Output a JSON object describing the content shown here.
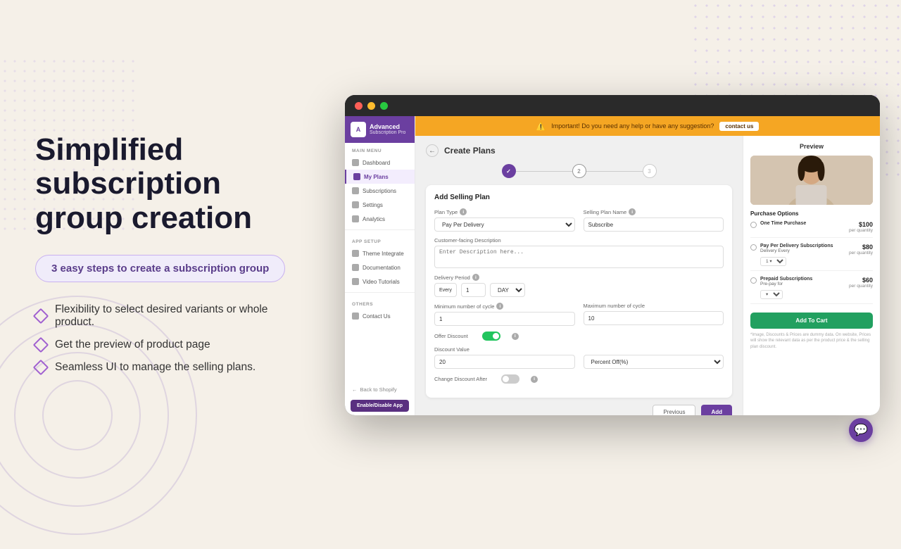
{
  "page": {
    "background": "#f5f0e8"
  },
  "left": {
    "title_line1": "Simplified subscription",
    "title_line2": "group creation",
    "badge": "3 easy steps to create a subscription group",
    "features": [
      "Flexibility to select desired variants or whole product.",
      "Get the preview of product page",
      "Seamless UI to manage the selling plans."
    ]
  },
  "app": {
    "title_bar": {
      "dot_red": "red",
      "dot_yellow": "yellow",
      "dot_green": "green"
    },
    "sidebar": {
      "logo_text": "Advanced",
      "logo_sub": "Subscription Pro",
      "main_menu_label": "MAIN MENU",
      "items": [
        {
          "label": "Dashboard",
          "active": false
        },
        {
          "label": "My Plans",
          "active": true
        },
        {
          "label": "Subscriptions",
          "active": false
        },
        {
          "label": "Settings",
          "active": false
        },
        {
          "label": "Analytics",
          "active": false
        }
      ],
      "app_setup_label": "APP SETUP",
      "setup_items": [
        {
          "label": "Theme Integrate"
        },
        {
          "label": "Documentation"
        },
        {
          "label": "Video Tutorials"
        }
      ],
      "others_label": "OTHERS",
      "other_items": [
        {
          "label": "Contact Us"
        }
      ],
      "back_to_shopify": "Back to Shopify",
      "enable_btn": "Enable/Disable App"
    },
    "warning_bar": {
      "text": "Important! Do you need any help or have any suggestion?",
      "contact_btn": "contact us"
    },
    "form": {
      "title": "Create Plans",
      "steps": [
        {
          "label": "✓",
          "state": "done"
        },
        {
          "label": "2",
          "state": "current"
        },
        {
          "label": "3",
          "state": "future"
        }
      ],
      "card_title": "Add Selling Plan",
      "plan_type_label": "Plan Type",
      "plan_type_value": "Pay Per Delivery",
      "selling_plan_name_label": "Selling Plan Name",
      "selling_plan_name_value": "Subscribe",
      "description_label": "Customer-facing Description",
      "description_placeholder": "Enter Description here...",
      "delivery_period_label": "Delivery Period",
      "delivery_every_label": "Every",
      "delivery_value": "1",
      "delivery_day": "DAY",
      "min_cycle_label": "Minimum number of cycle",
      "min_cycle_value": "1",
      "max_cycle_label": "Maximum number of cycle",
      "max_cycle_value": "10",
      "offer_discount_label": "Offer Discount",
      "toggle_state": "on",
      "discount_value_label": "Discount Value",
      "discount_value": "20",
      "percent_label": "Percent Off(%)",
      "change_discount_label": "Change Discount After",
      "change_discount_toggle": "off",
      "btn_previous": "Previous",
      "btn_add": "Add"
    },
    "preview": {
      "title": "Preview",
      "purchase_options_label": "Purchase Options",
      "options": [
        {
          "name": "One Time Purchase",
          "price": "$100",
          "price_sub": "per quantity"
        },
        {
          "name": "Pay Per Delivery Subscriptions",
          "price": "$80",
          "price_sub": "per quantity",
          "sub_label": "Delivery Every",
          "sub_select": "1 ▼"
        },
        {
          "name": "Prepaid Subscriptions",
          "price": "$60",
          "price_sub": "per quantity",
          "sub_label": "Pre-pay for",
          "sub_select": "▼"
        }
      ],
      "add_to_cart_btn": "Add To Cart",
      "note": "*Image, Discounts & Prices are dummy data. On website, Prices will show the relevant data as per the product price & the selling plan discount."
    }
  },
  "chat": {
    "icon": "💬"
  }
}
